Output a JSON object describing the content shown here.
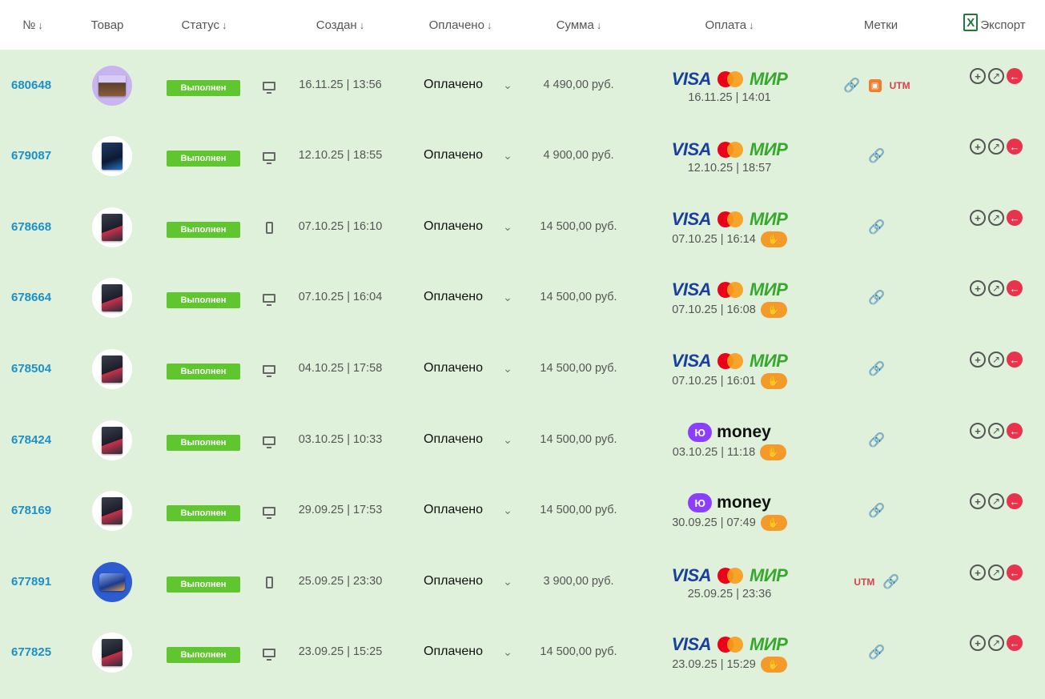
{
  "header": {
    "num": "№",
    "num_arrow": "↓",
    "product": "Товар",
    "status": "Статус",
    "status_arrow": "↓",
    "created": "Создан",
    "created_arrow": "↓",
    "paid": "Оплачено",
    "paid_arrow": "↓",
    "sum": "Сумма",
    "sum_arrow": "↓",
    "payment": "Оплата",
    "payment_arrow": "↓",
    "tags": "Метки",
    "export_icon": "X",
    "export": "Экспорт"
  },
  "rows": [
    {
      "id": "680648",
      "status": "Выполнен",
      "created": "16.11.25 | 13:56",
      "paid": "Оплачено",
      "chev": "⌄",
      "sum": "4 490,00 руб.",
      "pay_visa": "VISA",
      "pay_mir": "МИР",
      "pay_date": "16.11.25 | 14:01",
      "hand": "✋",
      "tag_utm": "UTM"
    },
    {
      "id": "679087",
      "status": "Выполнен",
      "created": "12.10.25 | 18:55",
      "paid": "Оплачено",
      "chev": "⌄",
      "sum": "4 900,00 руб.",
      "pay_visa": "VISA",
      "pay_mir": "МИР",
      "pay_date": "12.10.25 | 18:57"
    },
    {
      "id": "678668",
      "status": "Выполнен",
      "created": "07.10.25 | 16:10",
      "paid": "Оплачено",
      "chev": "⌄",
      "sum": "14 500,00 руб.",
      "pay_visa": "VISA",
      "pay_mir": "МИР",
      "pay_date": "07.10.25 | 16:14",
      "hand": "✋"
    },
    {
      "id": "678664",
      "status": "Выполнен",
      "created": "07.10.25 | 16:04",
      "paid": "Оплачено",
      "chev": "⌄",
      "sum": "14 500,00 руб.",
      "pay_visa": "VISA",
      "pay_mir": "МИР",
      "pay_date": "07.10.25 | 16:08",
      "hand": "✋"
    },
    {
      "id": "678504",
      "status": "Выполнен",
      "created": "04.10.25 | 17:58",
      "paid": "Оплачено",
      "chev": "⌄",
      "sum": "14 500,00 руб.",
      "pay_visa": "VISA",
      "pay_mir": "МИР",
      "pay_date": "07.10.25 | 16:01",
      "hand": "✋"
    },
    {
      "id": "678424",
      "status": "Выполнен",
      "created": "03.10.25 | 10:33",
      "paid": "Оплачено",
      "chev": "⌄",
      "sum": "14 500,00 руб.",
      "pay_money_mark": "Ю",
      "pay_money": "money",
      "pay_date": "03.10.25 | 11:18",
      "hand": "✋"
    },
    {
      "id": "678169",
      "status": "Выполнен",
      "created": "29.09.25 | 17:53",
      "paid": "Оплачено",
      "chev": "⌄",
      "sum": "14 500,00 руб.",
      "pay_money_mark": "Ю",
      "pay_money": "money",
      "pay_date": "30.09.25 | 07:49",
      "hand": "✋"
    },
    {
      "id": "677891",
      "status": "Выполнен",
      "created": "25.09.25 | 23:30",
      "paid": "Оплачено",
      "chev": "⌄",
      "sum": "3 900,00 руб.",
      "pay_visa": "VISA",
      "pay_mir": "МИР",
      "pay_date": "25.09.25 | 23:36",
      "tag_utm": "UTM"
    },
    {
      "id": "677825",
      "status": "Выполнен",
      "created": "23.09.25 | 15:25",
      "paid": "Оплачено",
      "chev": "⌄",
      "sum": "14 500,00 руб.",
      "pay_visa": "VISA",
      "pay_mir": "МИР",
      "pay_date": "23.09.25 | 15:29",
      "hand": "✋"
    }
  ],
  "icons": {
    "link": "🔗",
    "calendar": "▣",
    "zoom": "+",
    "edit": "↗",
    "back": "←"
  },
  "colors": {
    "row_bg": "#dff0db",
    "order_link": "#1f8fc7",
    "status_bg": "#5fc62f",
    "visa": "#1a3f9c",
    "mir": "#37a72e",
    "hand_badge": "#f49a2a",
    "yoomoney": "#8b3ffd",
    "back_button": "#e8334d",
    "utm": "#d9414f"
  }
}
